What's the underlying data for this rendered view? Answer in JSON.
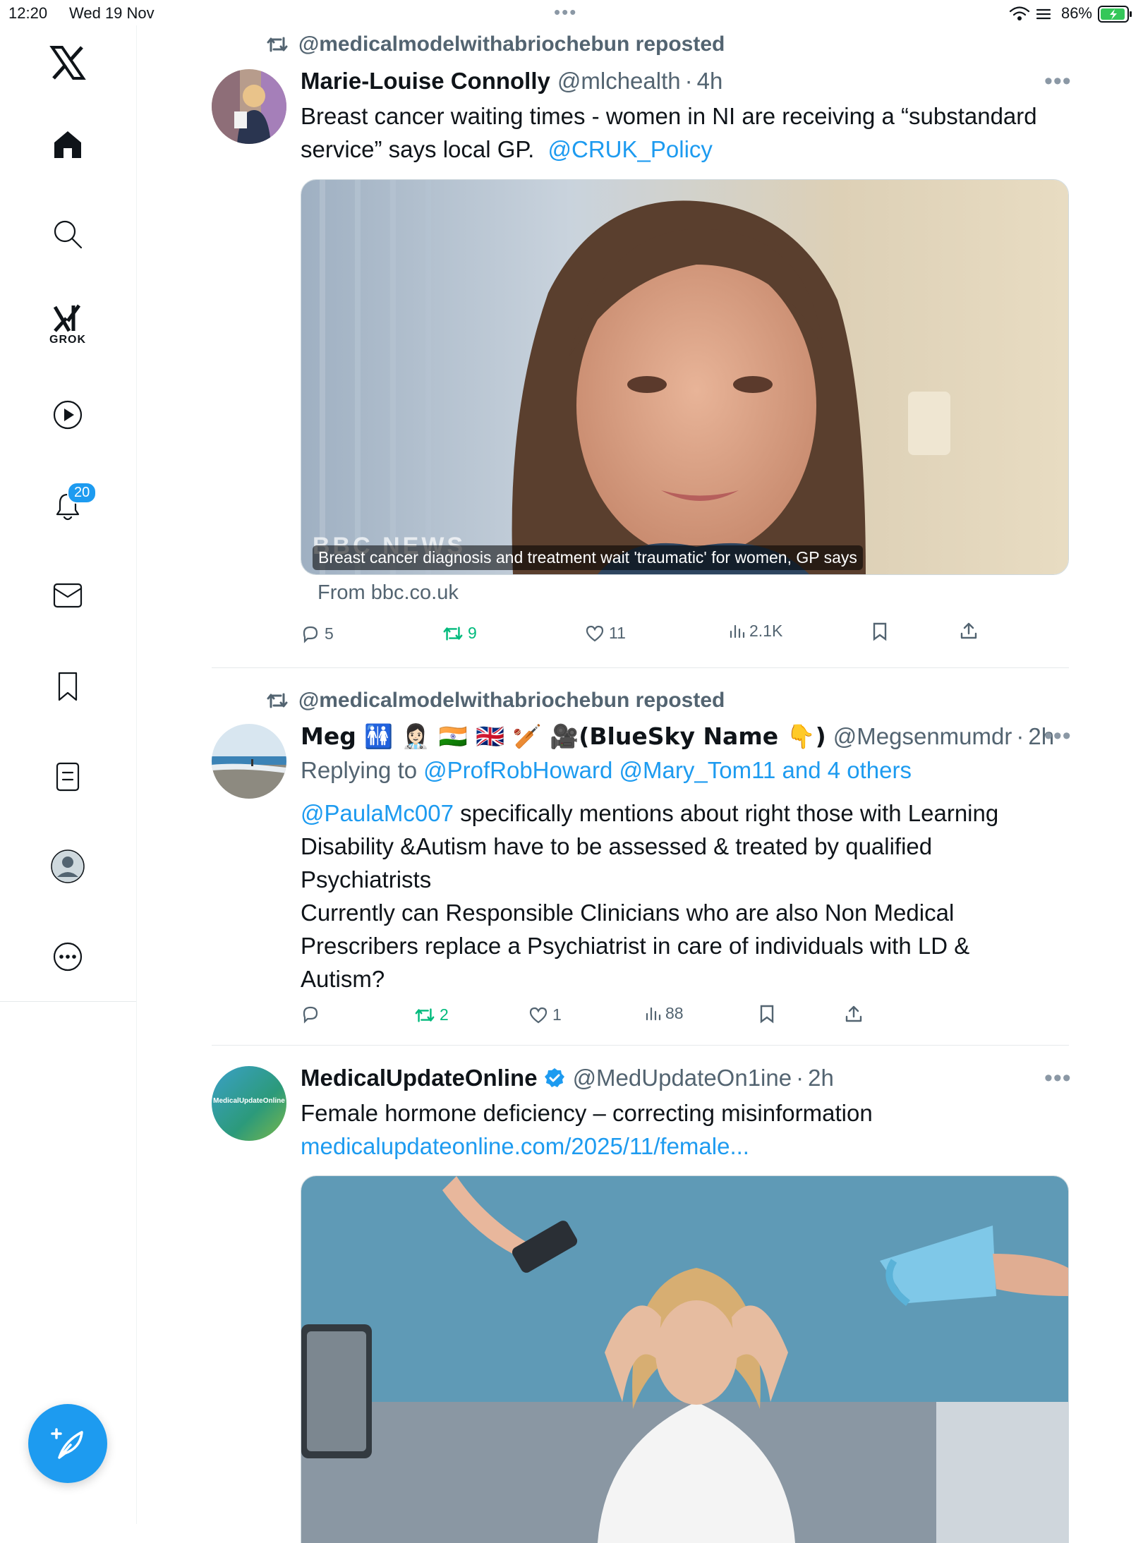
{
  "status_bar": {
    "time": "12:20",
    "date": "Wed 19 Nov",
    "battery": "86%"
  },
  "sidebar": {
    "grok_label": "GROK",
    "notification_count": "20"
  },
  "tweets": [
    {
      "repost_by": "@medicalmodelwithabriochebun reposted",
      "name": "Marie-Louise Connolly",
      "handle": "@mlchealth",
      "time": "4h",
      "text": "Breast cancer waiting times - women in NI are receiving a “substandard service” says local GP.",
      "mention": "@CRUK_Policy",
      "card_watermark": "BBC NEWS",
      "card_caption": "Breast cancer diagnosis and treatment wait 'traumatic' for women, GP says",
      "card_source": "From bbc.co.uk",
      "replies": "5",
      "reposts": "9",
      "likes": "11",
      "views": "2.1K"
    },
    {
      "repost_by": "@medicalmodelwithabriochebun reposted",
      "name": "Meg 🚻 👩🏻‍⚕️ 🇮🇳 🇬🇧 🏏 🎥(BlueSky Name 👇)",
      "handle": "@Megsenmumdr",
      "time": "2h",
      "replying_prefix": "Replying to",
      "replying_to": "@ProfRobHoward @Mary_Tom11 and 4 others",
      "mention": "@PaulaMc007",
      "text1": "specifically mentions about right those with Learning Disability &Autism have to be assessed & treated by qualified Psychiatrists",
      "text2": "Currently can Responsible Clinicians who are also Non Medical Prescribers replace a Psychiatrist in care of individuals with LD & Autism?",
      "reposts": "2",
      "likes": "1",
      "views": "88"
    },
    {
      "name": "MedicalUpdateOnline",
      "handle": "@MedUpdateOn1ine",
      "time": "2h",
      "avatar_text": "MedicalUpdateOnline",
      "text": "Female hormone deficiency – correcting misinformation",
      "link": "medicalupdateonline.com/2025/11/female..."
    }
  ],
  "colors": {
    "accent": "#1d9bf0",
    "repost_green": "#00ba7c",
    "muted": "#536471"
  }
}
